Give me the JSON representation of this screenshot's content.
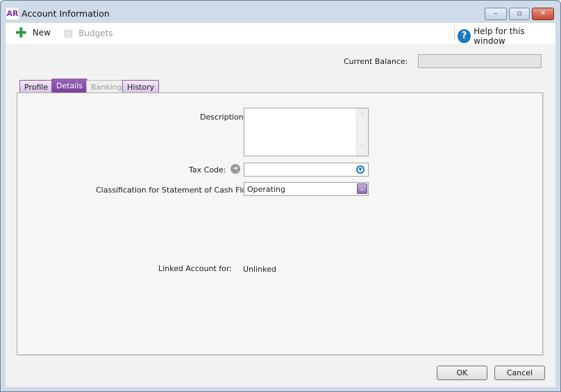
{
  "window": {
    "app_icon": "AR",
    "title": "Account Information",
    "minimize": "–",
    "maximize": "▫",
    "close": "✕"
  },
  "toolbar": {
    "new_label": "New",
    "budgets_label": "Budgets",
    "help_label": "Help for this window",
    "help_glyph": "?"
  },
  "header": {
    "current_balance_label": "Current Balance:",
    "current_balance_value": ""
  },
  "tabs": [
    {
      "label": "Profile"
    },
    {
      "label": "Details",
      "active": true
    },
    {
      "label": "Banking",
      "disabled": true
    },
    {
      "label": "History"
    }
  ],
  "details": {
    "description_label": "Description:",
    "description_value": "",
    "tax_code_label": "Tax Code:",
    "tax_code_value": "",
    "classification_label": "Classification for Statement of Cash Flows:",
    "classification_value": "Operating",
    "linked_label": "Linked Account for:",
    "linked_value": "Unlinked"
  },
  "footer": {
    "ok_label": "OK",
    "cancel_label": "Cancel"
  }
}
